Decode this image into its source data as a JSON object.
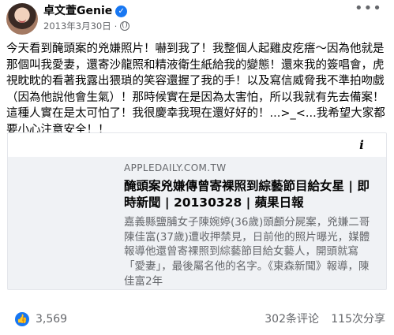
{
  "post": {
    "author": "卓文萱Genie",
    "date": "2013年3月30日",
    "separator": "·",
    "text": "今天看到醃頭案的兇嫌照片！嚇到我了！我整個人起雞皮疙瘩～因為他就是那個叫我愛妻，還寄沙龍照和精液衛生紙給我的變態！還來我的簽唱會，虎視眈眈的看著我露出猥瑣的笑容還握了我的手！以及寫信威脅我不準拍吻戲（因為他說他會生氣）！那時候實在是因為太害怕，所以我就有先去備案！這種人實在是太可怕了！我很慶幸我現在還好好的！...>_<...我希望大家都要小心注意安全！！"
  },
  "link_card": {
    "domain": "APPLEDAILY.COM.TW",
    "title": "醃頭案兇嫌傳曾寄裸照到綜藝節目給女星 | 即時新聞 | 20130328 | 蘋果日報",
    "description": "嘉義縣鹽脯女子陳婉婷(36歲)頭顱分屍案，兇嫌二哥陳佳富(37歲)遭收押禁見，日前他的照片曝光，媒體報導他還曾寄裸照到綜藝節目給女藝人，開頭就寫「愛妻」，最後屬名他的名字。《東森新聞》報導，陳佳富2年"
  },
  "stats": {
    "likes": "3,569",
    "comments": "302条评论",
    "shares": "115次分享"
  },
  "icons": {
    "verified": "verified-badge-icon",
    "audience": "globe-icon",
    "more": "more-options-icon",
    "info": "info-icon",
    "reaction": "like-reaction-icon"
  },
  "colors": {
    "accent": "#1877f2",
    "secondary_text": "#65676b",
    "card_background": "#f0f2f5"
  }
}
